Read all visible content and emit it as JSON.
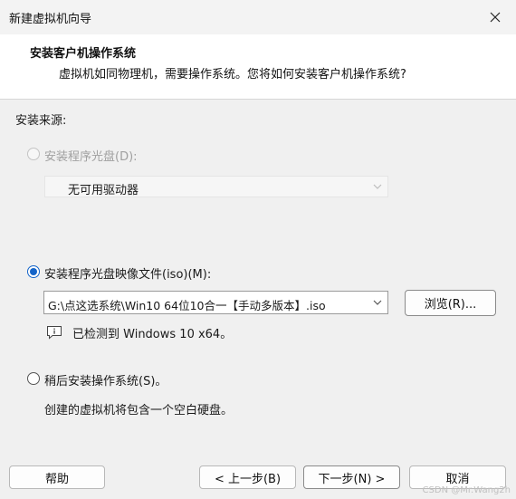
{
  "window": {
    "title": "新建虚拟机向导"
  },
  "header": {
    "title": "安装客户机操作系统",
    "subtitle": "虚拟机如同物理机，需要操作系统。您将如何安装客户机操作系统?"
  },
  "source": {
    "label": "安装来源:",
    "disc_option": {
      "label": "安装程序光盘(D):",
      "selected": false,
      "enabled": false
    },
    "disc_dropdown": {
      "value": "无可用驱动器"
    },
    "iso_option": {
      "label": "安装程序光盘映像文件(iso)(M):",
      "selected": true
    },
    "iso_dropdown": {
      "value": "G:\\点这选系统\\Win10 64位10合一【手动多版本】.iso"
    },
    "browse_label": "浏览(R)...",
    "detected_text": "已检测到 Windows 10 x64。",
    "later_option": {
      "label": "稍后安装操作系统(S)。",
      "selected": false
    },
    "later_desc": "创建的虚拟机将包含一个空白硬盘。"
  },
  "footer": {
    "help": "帮助",
    "back": "< 上一步(B)",
    "next": "下一步(N) >",
    "cancel": "取消"
  },
  "watermark": "CSDN @Mr.Wang2h",
  "colors": {
    "accent": "#1464c8",
    "header_bg": "#ffffff",
    "dialog_bg": "#f0f0f0"
  },
  "icons": {
    "close": "close-icon",
    "dropdown": "chevron-down-icon",
    "info": "info-icon"
  }
}
